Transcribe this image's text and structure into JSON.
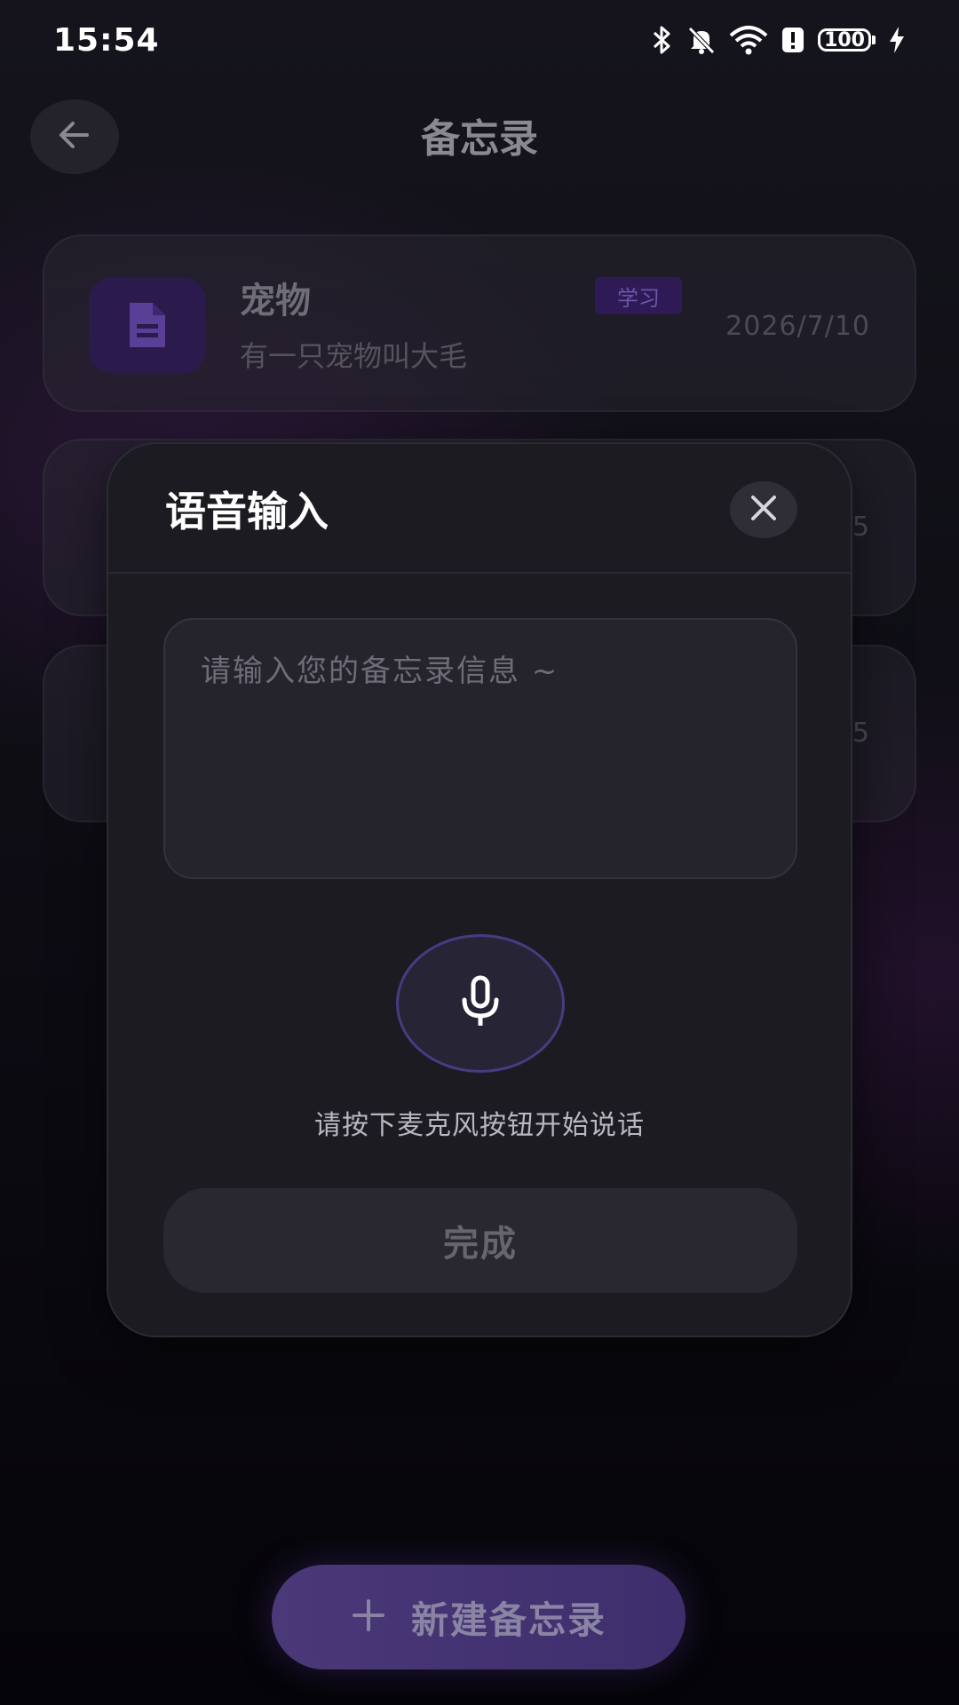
{
  "status_bar": {
    "time": "15:54",
    "battery": "100",
    "icons": [
      "bluetooth-icon",
      "notifications-off-icon",
      "wifi-icon",
      "alert-icon",
      "battery-icon",
      "charging-icon"
    ]
  },
  "header": {
    "title": "备忘录",
    "back_icon": "arrow-left-icon"
  },
  "memos": [
    {
      "title": "宠物",
      "description": "有一只宠物叫大毛",
      "tag": "学习",
      "date": "2026/7/10",
      "icon": "document-icon"
    },
    {
      "date_partial": "5"
    },
    {
      "date_partial": "5"
    }
  ],
  "dialog": {
    "title": "语音输入",
    "close_icon": "close-icon",
    "input_placeholder": "请输入您的备忘录信息 ~",
    "input_value": "",
    "mic_icon": "microphone-icon",
    "mic_hint": "请按下麦克风按钮开始说话",
    "done_label": "完成"
  },
  "new_memo_button": {
    "icon": "plus-icon",
    "label": "新建备忘录"
  },
  "colors": {
    "background": "#0b0a10",
    "dialog_bg": "#1c1b22",
    "accent_purple": "#4a3a82",
    "tag_bg": "#2e1a55"
  }
}
